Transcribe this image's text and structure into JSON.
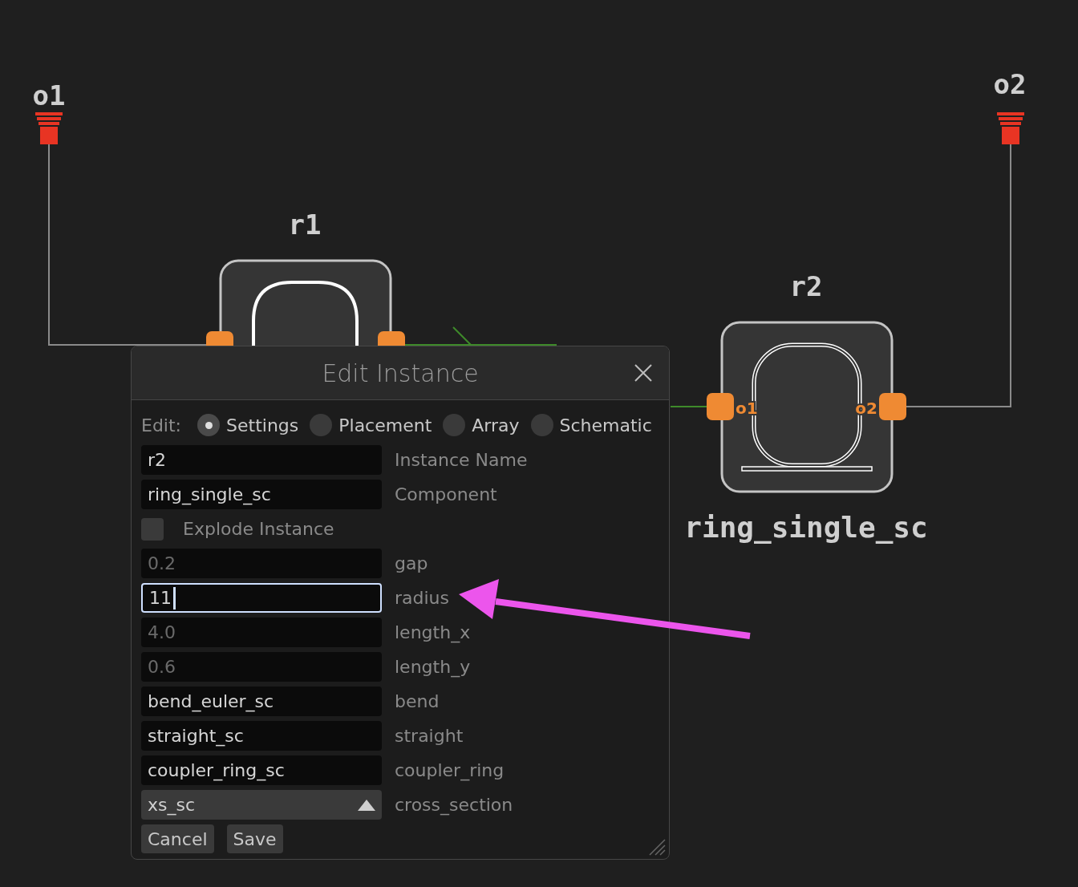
{
  "canvas": {
    "pins": [
      {
        "label": "o1"
      },
      {
        "label": "o2"
      }
    ],
    "instances": [
      {
        "name": "r1"
      },
      {
        "name": "r2",
        "component": "ring_single_sc",
        "ports": [
          "o1",
          "o2"
        ]
      }
    ]
  },
  "dialog": {
    "title": "Edit Instance",
    "edit_label": "Edit:",
    "modes": [
      {
        "label": "Settings",
        "selected": true
      },
      {
        "label": "Placement",
        "selected": false
      },
      {
        "label": "Array",
        "selected": false
      },
      {
        "label": "Schematic",
        "selected": false
      }
    ],
    "instance_fields": [
      {
        "kind": "text",
        "value": "r2",
        "label": "Instance Name",
        "focused": false
      },
      {
        "kind": "text",
        "value": "ring_single_sc",
        "label": "Component",
        "focused": false
      }
    ],
    "explode": {
      "label": "Explode Instance",
      "checked": false
    },
    "parameters": [
      {
        "kind": "text",
        "placeholder": "0.2",
        "label": "gap",
        "focused": false
      },
      {
        "kind": "text",
        "value": "11",
        "label": "radius",
        "focused": true
      },
      {
        "kind": "text",
        "placeholder": "4.0",
        "label": "length_x",
        "focused": false
      },
      {
        "kind": "text",
        "placeholder": "0.6",
        "label": "length_y",
        "focused": false
      },
      {
        "kind": "text",
        "value": "bend_euler_sc",
        "label": "bend",
        "focused": false
      },
      {
        "kind": "text",
        "value": "straight_sc",
        "label": "straight",
        "focused": false
      },
      {
        "kind": "text",
        "value": "coupler_ring_sc",
        "label": "coupler_ring",
        "focused": false
      },
      {
        "kind": "select",
        "value": "xs_sc",
        "label": "cross_section"
      }
    ],
    "buttons": [
      "Cancel",
      "Save"
    ]
  }
}
